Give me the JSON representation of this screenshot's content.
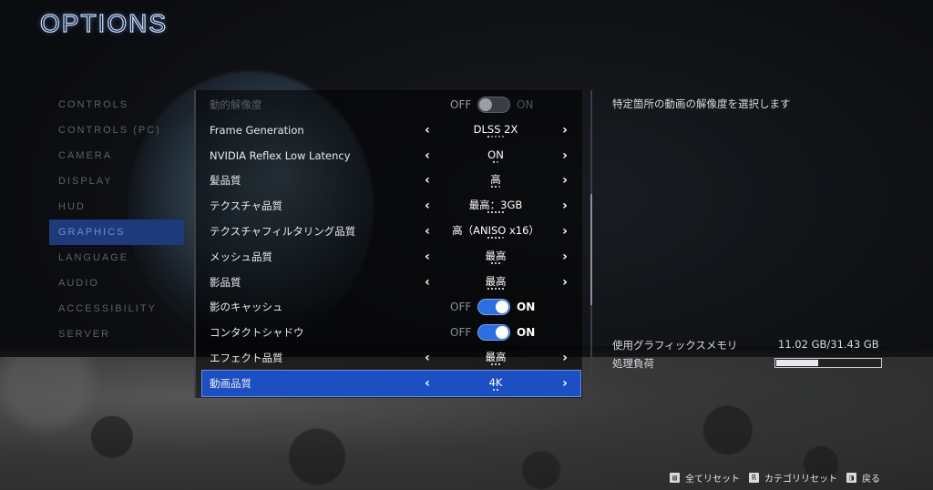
{
  "header": {
    "title": "OPTIONS"
  },
  "nav": {
    "items": [
      {
        "label": "CONTROLS",
        "active": false
      },
      {
        "label": "CONTROLS (PC)",
        "active": false
      },
      {
        "label": "CAMERA",
        "active": false
      },
      {
        "label": "DISPLAY",
        "active": false
      },
      {
        "label": "HUD",
        "active": false
      },
      {
        "label": "GRAPHICS",
        "active": true
      },
      {
        "label": "LANGUAGE",
        "active": false
      },
      {
        "label": "AUDIO",
        "active": false
      },
      {
        "label": "ACCESSIBILITY",
        "active": false
      },
      {
        "label": "SERVER",
        "active": false
      }
    ]
  },
  "settings": {
    "rows": [
      {
        "label": "動的解像度",
        "type": "toggle",
        "off_label": "OFF",
        "on_label": "ON",
        "state": "off",
        "dim": true
      },
      {
        "label": "Frame Generation",
        "type": "select",
        "value": "DLSS 2X",
        "level": 1,
        "steps": 5
      },
      {
        "label": "NVIDIA Reflex Low Latency",
        "type": "select",
        "value": "ON",
        "level": 1,
        "steps": 2
      },
      {
        "label": "髪品質",
        "type": "select",
        "value": "高",
        "level": 2,
        "steps": 3
      },
      {
        "label": "テクスチャ品質",
        "type": "select",
        "value": "最高：3GB",
        "level": 5,
        "steps": 5
      },
      {
        "label": "テクスチャフィルタリング品質",
        "type": "select",
        "value": "高（ANISO x16）",
        "level": 4,
        "steps": 5
      },
      {
        "label": "メッシュ品質",
        "type": "select",
        "value": "最高",
        "level": 3,
        "steps": 3
      },
      {
        "label": "影品質",
        "type": "select",
        "value": "最高",
        "level": 5,
        "steps": 5
      },
      {
        "label": "影のキャッシュ",
        "type": "toggle",
        "off_label": "OFF",
        "on_label": "ON",
        "state": "on"
      },
      {
        "label": "コンタクトシャドウ",
        "type": "toggle",
        "off_label": "OFF",
        "on_label": "ON",
        "state": "on"
      },
      {
        "label": "エフェクト品質",
        "type": "select",
        "value": "最高",
        "level": 3,
        "steps": 3
      },
      {
        "label": "動画品質",
        "type": "select",
        "value": "4K",
        "level": 2,
        "steps": 2,
        "selected": true
      }
    ]
  },
  "info": {
    "description": "特定箇所の動画の解像度を選択します",
    "vram_label": "使用グラフィックスメモリ",
    "vram_value": "11.02 GB/31.43 GB",
    "load_label": "処理負荷",
    "load_fraction": 0.4
  },
  "footer": {
    "hints": [
      {
        "key": "▤",
        "label": "全てリセット"
      },
      {
        "key": "R",
        "label": "カテゴリリセット"
      },
      {
        "key": "◨",
        "label": "戻る"
      }
    ]
  },
  "colors": {
    "accent": "#1b4fc2",
    "toggle_on": "#2a6fe0",
    "nav_active_bg": "#1d3a7a"
  }
}
